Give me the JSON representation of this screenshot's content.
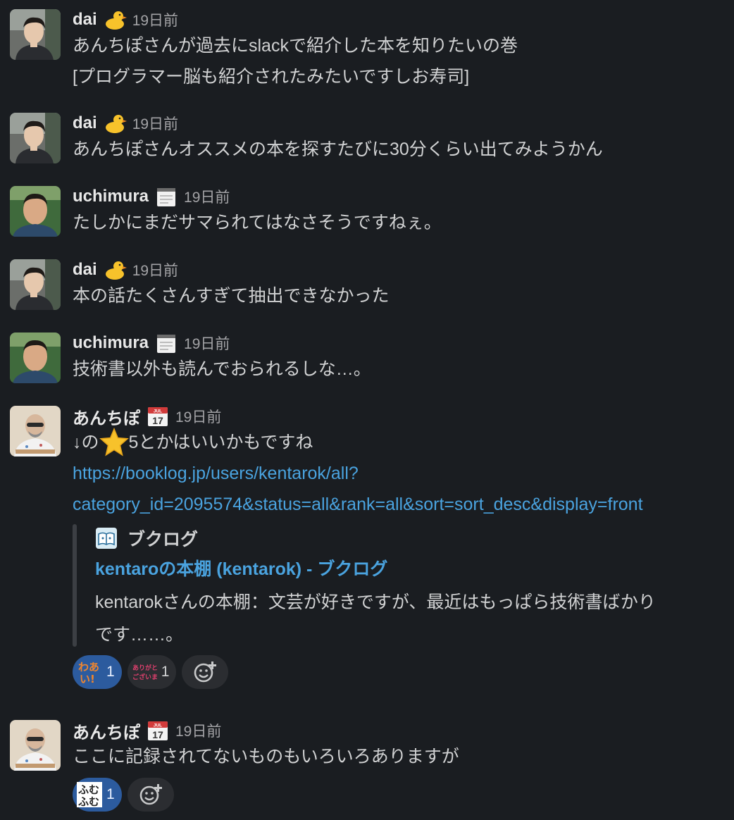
{
  "messages": [
    {
      "author": "dai",
      "status_icon": "duck-icon",
      "time": "19日前",
      "lines": [
        "あんちぽさんが過去にslackで紹介した本を知りたいの巻",
        "[プログラマー脳も紹介されたみたいですしお寿司]"
      ]
    },
    {
      "author": "dai",
      "status_icon": "duck-icon",
      "time": "19日前",
      "lines": [
        "あんちぽさんオススメの本を探すたびに30分くらい出てみようかん"
      ]
    },
    {
      "author": "uchimura",
      "status_icon": "spiral-notepad-icon",
      "time": "19日前",
      "lines": [
        "たしかにまだサマられてはなさそうですねぇ。"
      ]
    },
    {
      "author": "dai",
      "status_icon": "duck-icon",
      "time": "19日前",
      "lines": [
        "本の話たくさんすぎて抽出できなかった"
      ]
    },
    {
      "author": "uchimura",
      "status_icon": "spiral-notepad-icon",
      "time": "19日前",
      "lines": [
        "技術書以外も読んでおられるしな…。"
      ]
    },
    {
      "author": "あんちぽ",
      "status_icon": "calendar-icon",
      "time": "19日前",
      "text_before_star": "↓の",
      "star_icon": "star-icon",
      "text_after_star": "5とかはいいかもですね",
      "link_lines": [
        "https://booklog.jp/users/kentarok/all?",
        "category_id=2095574&status=all&rank=all&sort=sort_desc&display=front"
      ],
      "unfurl": {
        "source_icon": "booklog-icon",
        "source": "ブクログ",
        "title": "kentaroの本棚 (kentarok) - ブクログ",
        "desc_lines": [
          "kentarokさんの本棚：文芸が好きですが、最近はもっぱら技術書ばかり",
          "です……。"
        ]
      },
      "reactions": [
        {
          "emoji": "waai-emoji",
          "text": "わあい!",
          "count": "1",
          "mine": true
        },
        {
          "emoji": "arigatou-emoji",
          "text": "ありがとうございます",
          "count": "1",
          "mine": false
        }
      ]
    },
    {
      "author": "あんちぽ",
      "status_icon": "calendar-icon",
      "time": "19日前",
      "lines": [
        "ここに記録されてないものもいろいろありますが"
      ],
      "reactions": [
        {
          "emoji": "fumufumu-emoji",
          "text": "ふむふむ",
          "count": "1",
          "mine": true
        }
      ]
    }
  ],
  "colors": {
    "background": "#1a1d21",
    "link": "#4aa3df",
    "reaction_mine": "#2c5b9e"
  }
}
